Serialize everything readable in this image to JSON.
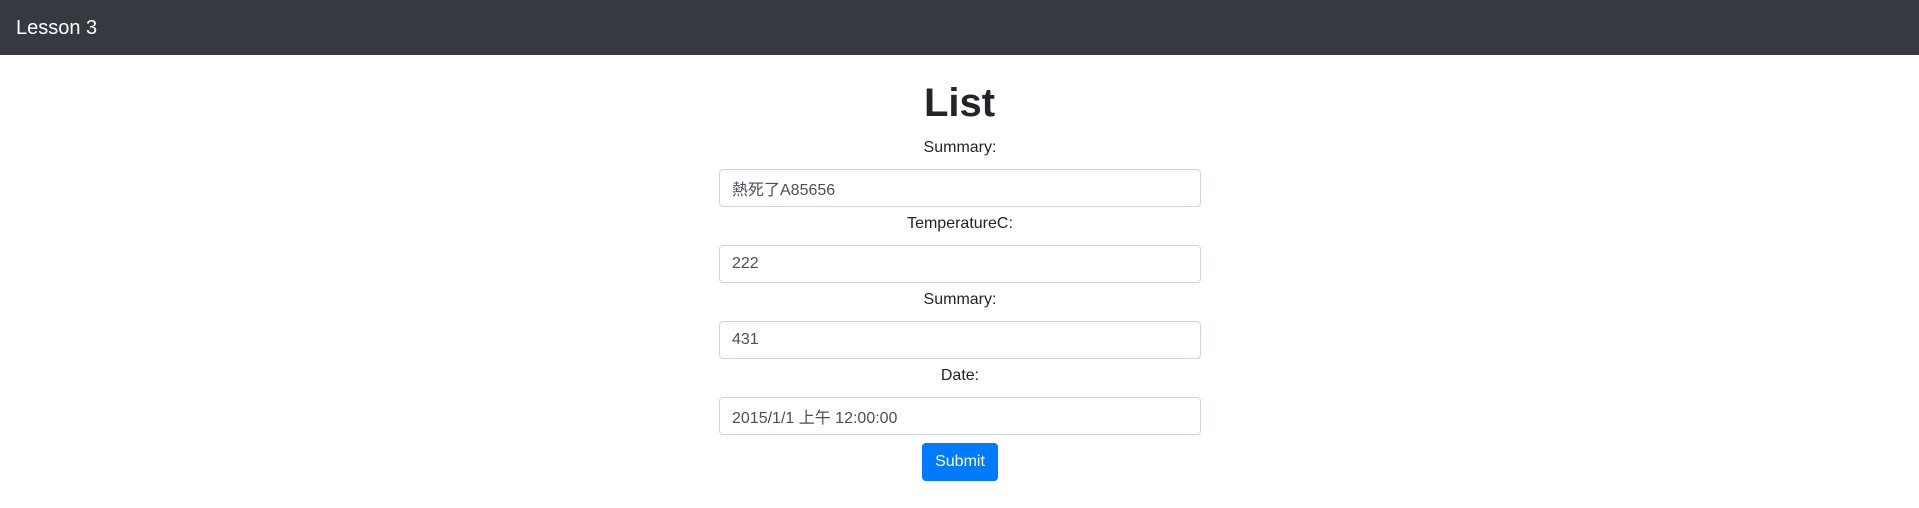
{
  "navbar": {
    "brand": "Lesson 3"
  },
  "page": {
    "title": "List"
  },
  "form": {
    "fields": [
      {
        "label": "Summary:",
        "value": "熱死了A85656"
      },
      {
        "label": "TemperatureC:",
        "value": "222"
      },
      {
        "label": "Summary:",
        "value": "431"
      },
      {
        "label": "Date:",
        "value": "2015/1/1 上午 12:00:00"
      }
    ],
    "submit_label": "Submit"
  },
  "colors": {
    "navbar_bg": "#343a40",
    "primary": "#007bff"
  }
}
